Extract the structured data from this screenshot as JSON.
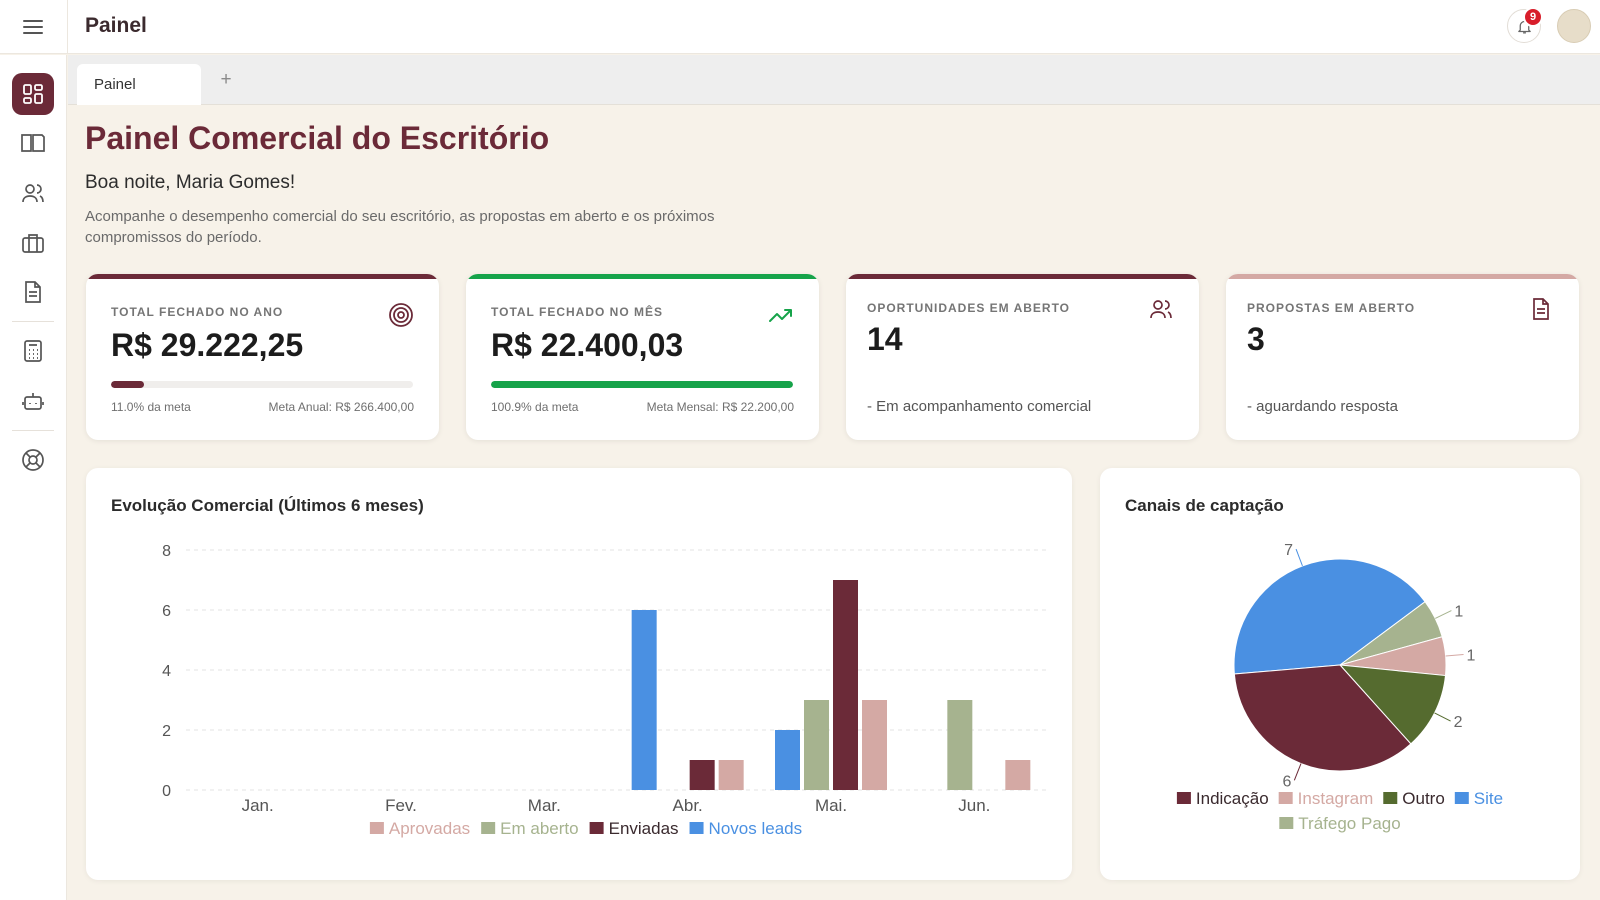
{
  "header": {
    "title": "Painel",
    "notifications_count": "9"
  },
  "sidebar": {
    "items": [
      {
        "icon": "dashboard-icon",
        "active": true
      },
      {
        "icon": "book-open-icon"
      },
      {
        "icon": "users-icon"
      },
      {
        "icon": "briefcase-icon"
      },
      {
        "icon": "document-icon"
      },
      {
        "icon": "calculator-icon"
      },
      {
        "icon": "robot-icon"
      },
      {
        "icon": "lifebuoy-icon"
      }
    ]
  },
  "tabs": {
    "active_label": "Painel",
    "add_label": "+"
  },
  "page": {
    "title": "Painel Comercial do Escritório",
    "greeting": "Boa noite, Maria Gomes!",
    "description": "Acompanhe o desempenho comercial do seu escritório, as propostas em aberto e os próximos compromissos do período."
  },
  "cards": {
    "year": {
      "label": "TOTAL FECHADO NO ANO",
      "value": "R$ 29.222,25",
      "pct_text": "11.0% da meta",
      "goal_text": "Meta Anual: R$ 266.400,00",
      "progress": 0.11,
      "color": "#6b2a38",
      "icon": "target-icon"
    },
    "month": {
      "label": "TOTAL FECHADO NO MÊS",
      "value": "R$ 22.400,03",
      "pct_text": "100.9% da meta",
      "goal_text": "Meta Mensal: R$ 22.200,00",
      "progress": 1.0,
      "color": "#16a34a",
      "icon": "trending-up-icon"
    },
    "opps": {
      "label": "OPORTUNIDADES EM ABERTO",
      "value": "14",
      "sub": "- Em acompanhamento comercial",
      "color": "#6b2a38",
      "icon": "users-icon"
    },
    "props": {
      "label": "PROPOSTAS EM ABERTO",
      "value": "3",
      "sub": "- aguardando resposta",
      "color": "#d4a9a4",
      "icon": "document-icon"
    }
  },
  "colors": {
    "brand": "#6b2a38",
    "aprovadas": "#d4a9a4",
    "em_aberto": "#a6b38f",
    "enviadas": "#6b2a38",
    "novos_leads": "#4a90e2",
    "outro": "#556b2f"
  },
  "chart_data": [
    {
      "type": "bar",
      "title": "Evolução Comercial (Últimos 6 meses)",
      "categories": [
        "Jan.",
        "Fev.",
        "Mar.",
        "Abr.",
        "Mai.",
        "Jun."
      ],
      "yticks": [
        0,
        2,
        4,
        6,
        8
      ],
      "ylim": [
        0,
        8
      ],
      "grid": true,
      "legend": "bottom",
      "series": [
        {
          "name": "Novos leads",
          "color": "#4a90e2",
          "values": [
            0,
            0,
            0,
            6,
            2,
            0
          ]
        },
        {
          "name": "Em aberto",
          "color": "#a6b38f",
          "values": [
            0,
            0,
            0,
            0,
            3,
            3
          ]
        },
        {
          "name": "Enviadas",
          "color": "#6b2a38",
          "values": [
            0,
            0,
            0,
            1,
            7,
            0
          ]
        },
        {
          "name": "Aprovadas",
          "color": "#d4a9a4",
          "values": [
            0,
            0,
            0,
            1,
            3,
            1
          ]
        }
      ],
      "legend_order": [
        "Aprovadas",
        "Em aberto",
        "Enviadas",
        "Novos leads"
      ]
    },
    {
      "type": "pie",
      "title": "Canais de captação",
      "legend": "bottom",
      "slices": [
        {
          "name": "Site",
          "value": 7,
          "color": "#4a90e2"
        },
        {
          "name": "Tráfego Pago",
          "value": 1,
          "color": "#a6b38f"
        },
        {
          "name": "Instagram",
          "value": 1,
          "color": "#d4a9a4"
        },
        {
          "name": "Outro",
          "value": 2,
          "color": "#556b2f"
        },
        {
          "name": "Indicação",
          "value": 6,
          "color": "#6b2a38"
        }
      ],
      "legend_order": [
        "Indicação",
        "Instagram",
        "Outro",
        "Site",
        "Tráfego Pago"
      ]
    }
  ]
}
